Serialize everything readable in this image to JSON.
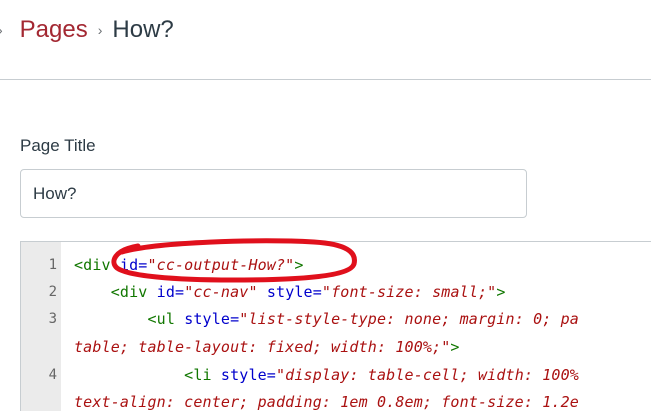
{
  "breadcrumb": {
    "separator": "›",
    "items": [
      {
        "label": "Pages"
      },
      {
        "label": "How?"
      }
    ]
  },
  "form": {
    "title_label": "Page Title",
    "title_value": "How?"
  },
  "editor": {
    "line_numbers": [
      "1",
      "2",
      "3",
      "",
      "4",
      ""
    ],
    "lines": [
      {
        "tag_open": "<div ",
        "attr1": "id=",
        "val1": "\"cc-output-How?\"",
        "tag_close": ">"
      },
      {
        "indent": "    ",
        "tag_open": "<div ",
        "attr1": "id=",
        "val1": "\"cc-nav\"",
        "sp": " ",
        "attr2": "style=",
        "val2": "\"font-size: small;\"",
        "tag_close": ">"
      },
      {
        "indent": "        ",
        "tag_open": "<ul ",
        "attr1": "style=",
        "val1": "\"list-style-type: none; margin: 0; pa"
      },
      {
        "val1": "table; table-layout: fixed; width: 100%;\"",
        "tag_close": ">"
      },
      {
        "indent": "            ",
        "tag_open": "<li ",
        "attr1": "style=",
        "val1": "\"display: table-cell; width: 100%"
      },
      {
        "val1": "text-align: center; padding: 1em 0.8em; font-size: 1.2e"
      }
    ]
  },
  "colors": {
    "link": "#a32832",
    "annotation": "#e0101c",
    "tag": "#117700",
    "attr": "#0000cc",
    "string": "#aa1111"
  }
}
